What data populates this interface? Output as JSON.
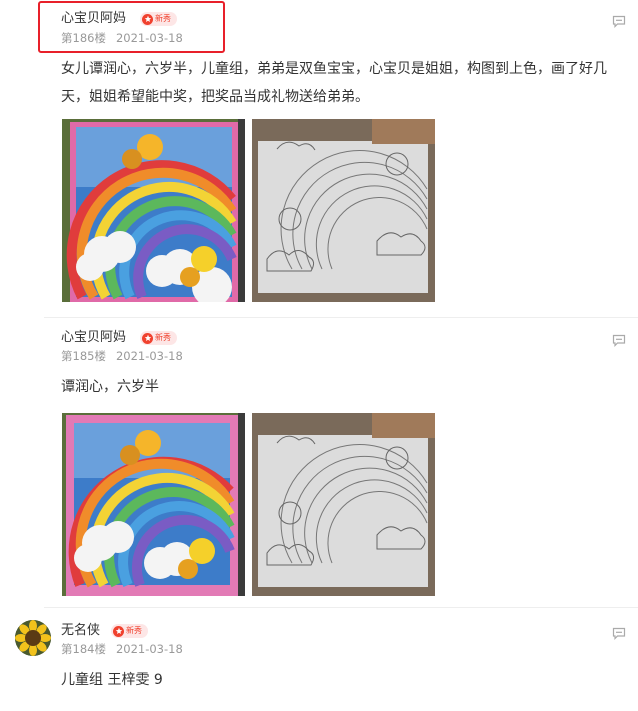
{
  "posts": [
    {
      "username": "心宝贝阿妈",
      "badge": "新秀",
      "floor": "第186楼",
      "date": "2021-03-18",
      "text": "女儿谭润心，六岁半，儿童组，弟弟是双鱼宝宝，心宝贝是姐姐，构图到上色，画了好几天，姐姐希望能中奖，把奖品当成礼物送给弟弟。",
      "images": [
        "colored-rainbow-drawing",
        "pencil-sketch-rainbow-drawing"
      ]
    },
    {
      "username": "心宝贝阿妈",
      "badge": "新秀",
      "floor": "第185楼",
      "date": "2021-03-18",
      "text": "谭润心，六岁半",
      "images": [
        "colored-rainbow-drawing",
        "pencil-sketch-rainbow-drawing"
      ]
    },
    {
      "username": "无名侠",
      "badge": "新秀",
      "floor": "第184楼",
      "date": "2021-03-18",
      "text": "儿童组 王梓雯 9",
      "avatar": "sunflower-avatar"
    }
  ],
  "colors": {
    "highlight_border": "#e8202a",
    "badge_bg": "#fde6e6",
    "badge_red": "#f0412e",
    "meta_gray": "#999999"
  },
  "icons": {
    "comment": "comment-bubble-icon",
    "badge": "star-badge-icon"
  }
}
